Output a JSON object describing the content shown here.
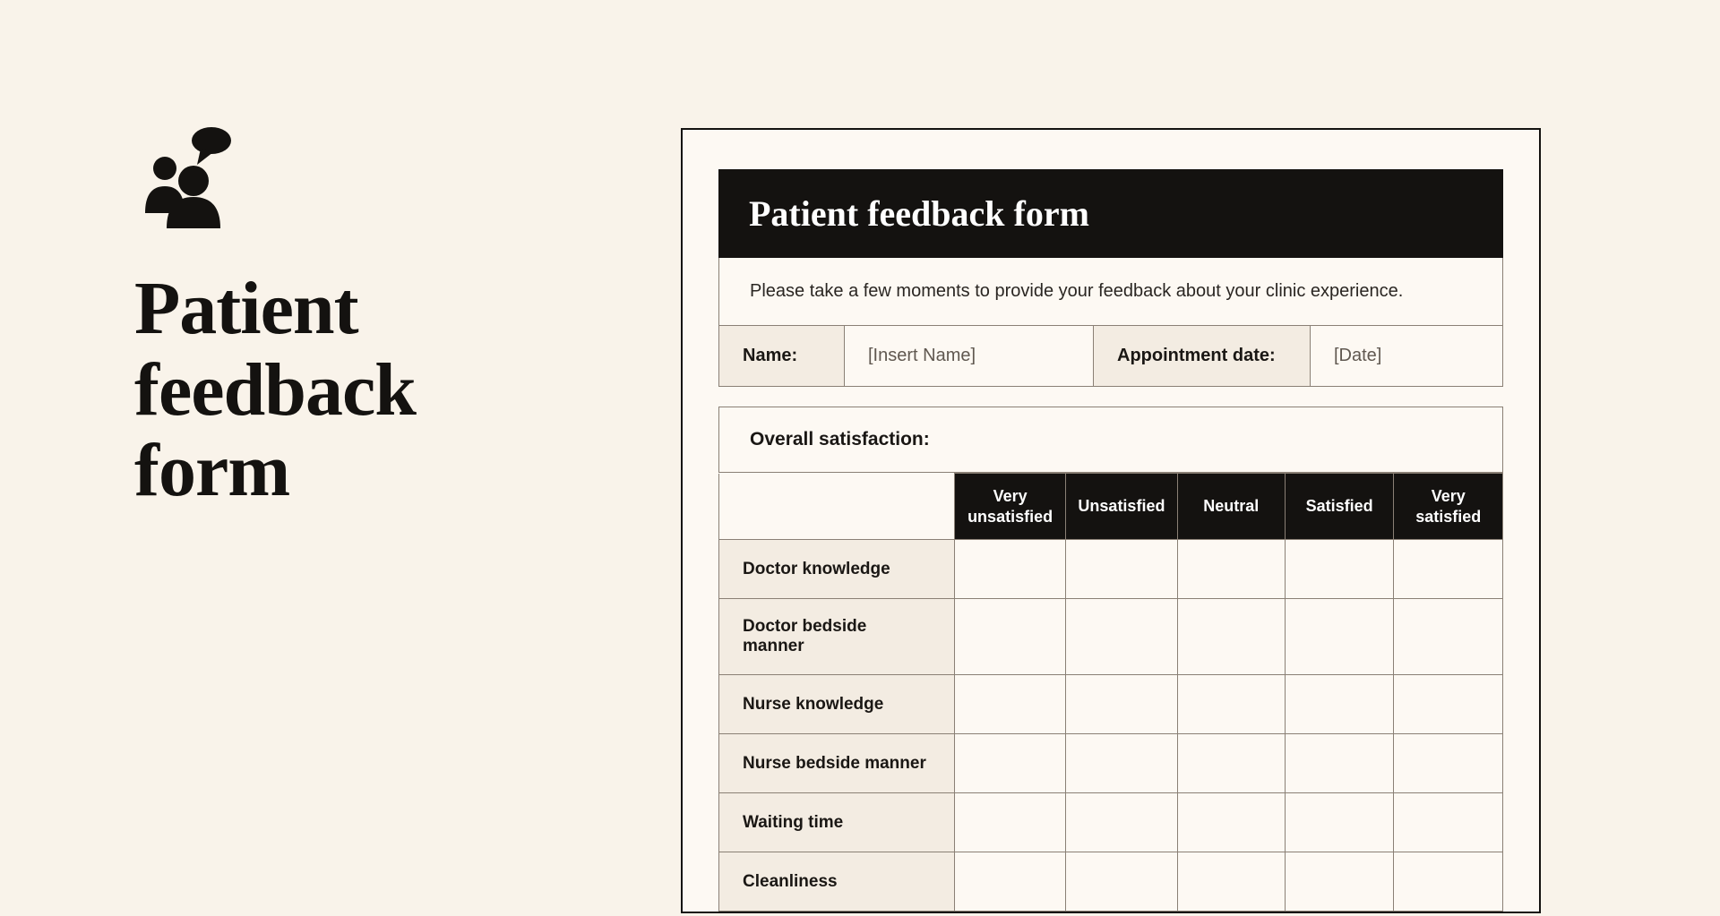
{
  "left": {
    "title": "Patient feedback form"
  },
  "form": {
    "header": "Patient feedback form",
    "intro": "Please take a few moments to provide your feedback about your clinic experience.",
    "fields": {
      "name_label": "Name:",
      "name_value": "[Insert Name]",
      "date_label": "Appointment date:",
      "date_value": "[Date]"
    },
    "section_title": "Overall satisfaction:",
    "rating_columns": [
      "Very unsatisfied",
      "Unsatisfied",
      "Neutral",
      "Satisfied",
      "Very satisfied"
    ],
    "rating_rows": [
      "Doctor knowledge",
      "Doctor bedside manner",
      "Nurse knowledge",
      "Nurse bedside manner",
      "Waiting time",
      "Cleanliness"
    ]
  }
}
